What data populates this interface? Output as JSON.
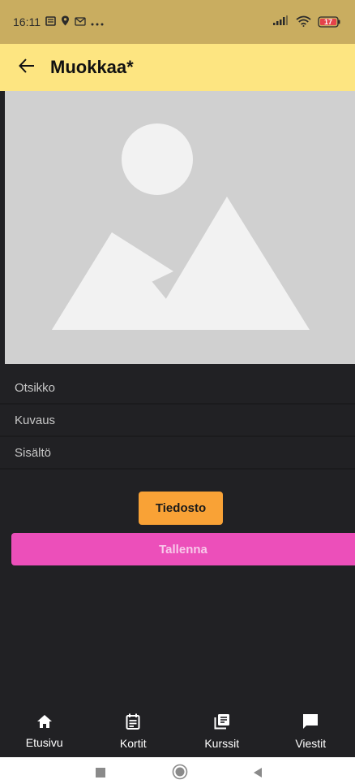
{
  "status_bar": {
    "time": "16:11",
    "left_icons": [
      "notification-icon",
      "location-icon",
      "mail-icon",
      "more-icon"
    ],
    "battery": "17",
    "right_icons": [
      "signal-icon",
      "wifi-icon",
      "battery-icon"
    ]
  },
  "app_bar": {
    "title": "Muokkaa*",
    "back_icon": "arrow-left-icon"
  },
  "image_placeholder": {
    "icon": "image-placeholder-icon"
  },
  "form": {
    "fields": [
      {
        "placeholder": "Otsikko"
      },
      {
        "placeholder": "Kuvaus"
      },
      {
        "placeholder": "Sisältö"
      }
    ],
    "file_button": "Tiedosto",
    "save_button": "Tallenna"
  },
  "bottom_nav": {
    "items": [
      {
        "label": "Etusivu",
        "icon": "home-icon"
      },
      {
        "label": "Kortit",
        "icon": "calendar-icon"
      },
      {
        "label": "Kurssit",
        "icon": "library-icon"
      },
      {
        "label": "Viestit",
        "icon": "chat-icon"
      }
    ]
  },
  "system_nav": {
    "icons": [
      "recent-apps-icon",
      "home-circle-icon",
      "back-triangle-icon"
    ]
  },
  "colors": {
    "status_bar": "#c9ad60",
    "app_bar": "#fde581",
    "background": "#212124",
    "file_button": "#f9a236",
    "save_button": "#ec4fba"
  }
}
